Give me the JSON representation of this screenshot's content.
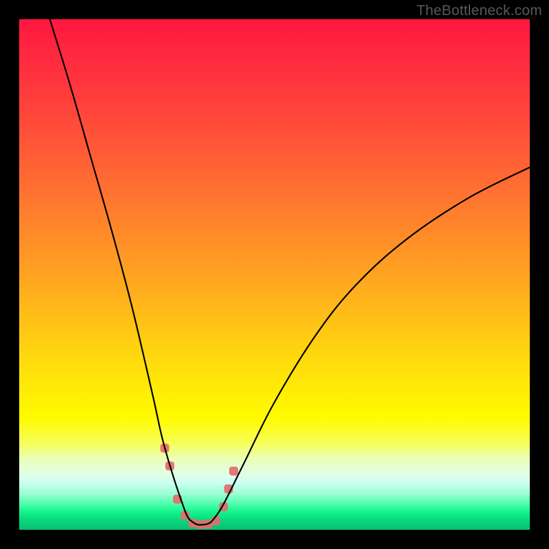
{
  "watermark": "TheBottleneck.com",
  "chart_data": {
    "type": "line",
    "title": "",
    "xlabel": "",
    "ylabel": "",
    "xlim": [
      0,
      100
    ],
    "ylim": [
      0,
      100
    ],
    "grid": false,
    "legend": false,
    "annotations": [],
    "background": {
      "type": "vertical-gradient",
      "stops": [
        {
          "pos": 0,
          "color": "#ff173f"
        },
        {
          "pos": 0.5,
          "color": "#ffa321"
        },
        {
          "pos": 0.78,
          "color": "#fffb00"
        },
        {
          "pos": 0.92,
          "color": "#98ffd1"
        },
        {
          "pos": 1.0,
          "color": "#07c071"
        }
      ]
    },
    "series": [
      {
        "name": "bottleneck-curve",
        "color": "#000000",
        "x": [
          6,
          10,
          14,
          18,
          22,
          26,
          28,
          30,
          32,
          33,
          34,
          35,
          36,
          37,
          38,
          40,
          44,
          50,
          58,
          66,
          76,
          88,
          100
        ],
        "y": [
          100,
          87,
          73,
          59,
          44,
          27,
          18,
          11,
          5,
          2.5,
          1.5,
          1,
          1,
          1.2,
          2,
          5,
          13,
          25,
          38,
          48,
          57,
          65,
          71
        ]
      },
      {
        "name": "marker-cluster",
        "type": "scatter",
        "color": "#e46d6d",
        "x": [
          28.5,
          29.5,
          31.0,
          32.5,
          34.0,
          35.5,
          37.0,
          38.5,
          40.0,
          41.0,
          42.0
        ],
        "y": [
          16.0,
          12.5,
          6.0,
          2.8,
          1.3,
          1.0,
          1.1,
          1.8,
          4.5,
          8.0,
          11.5
        ]
      }
    ],
    "optimum_x": 35
  }
}
